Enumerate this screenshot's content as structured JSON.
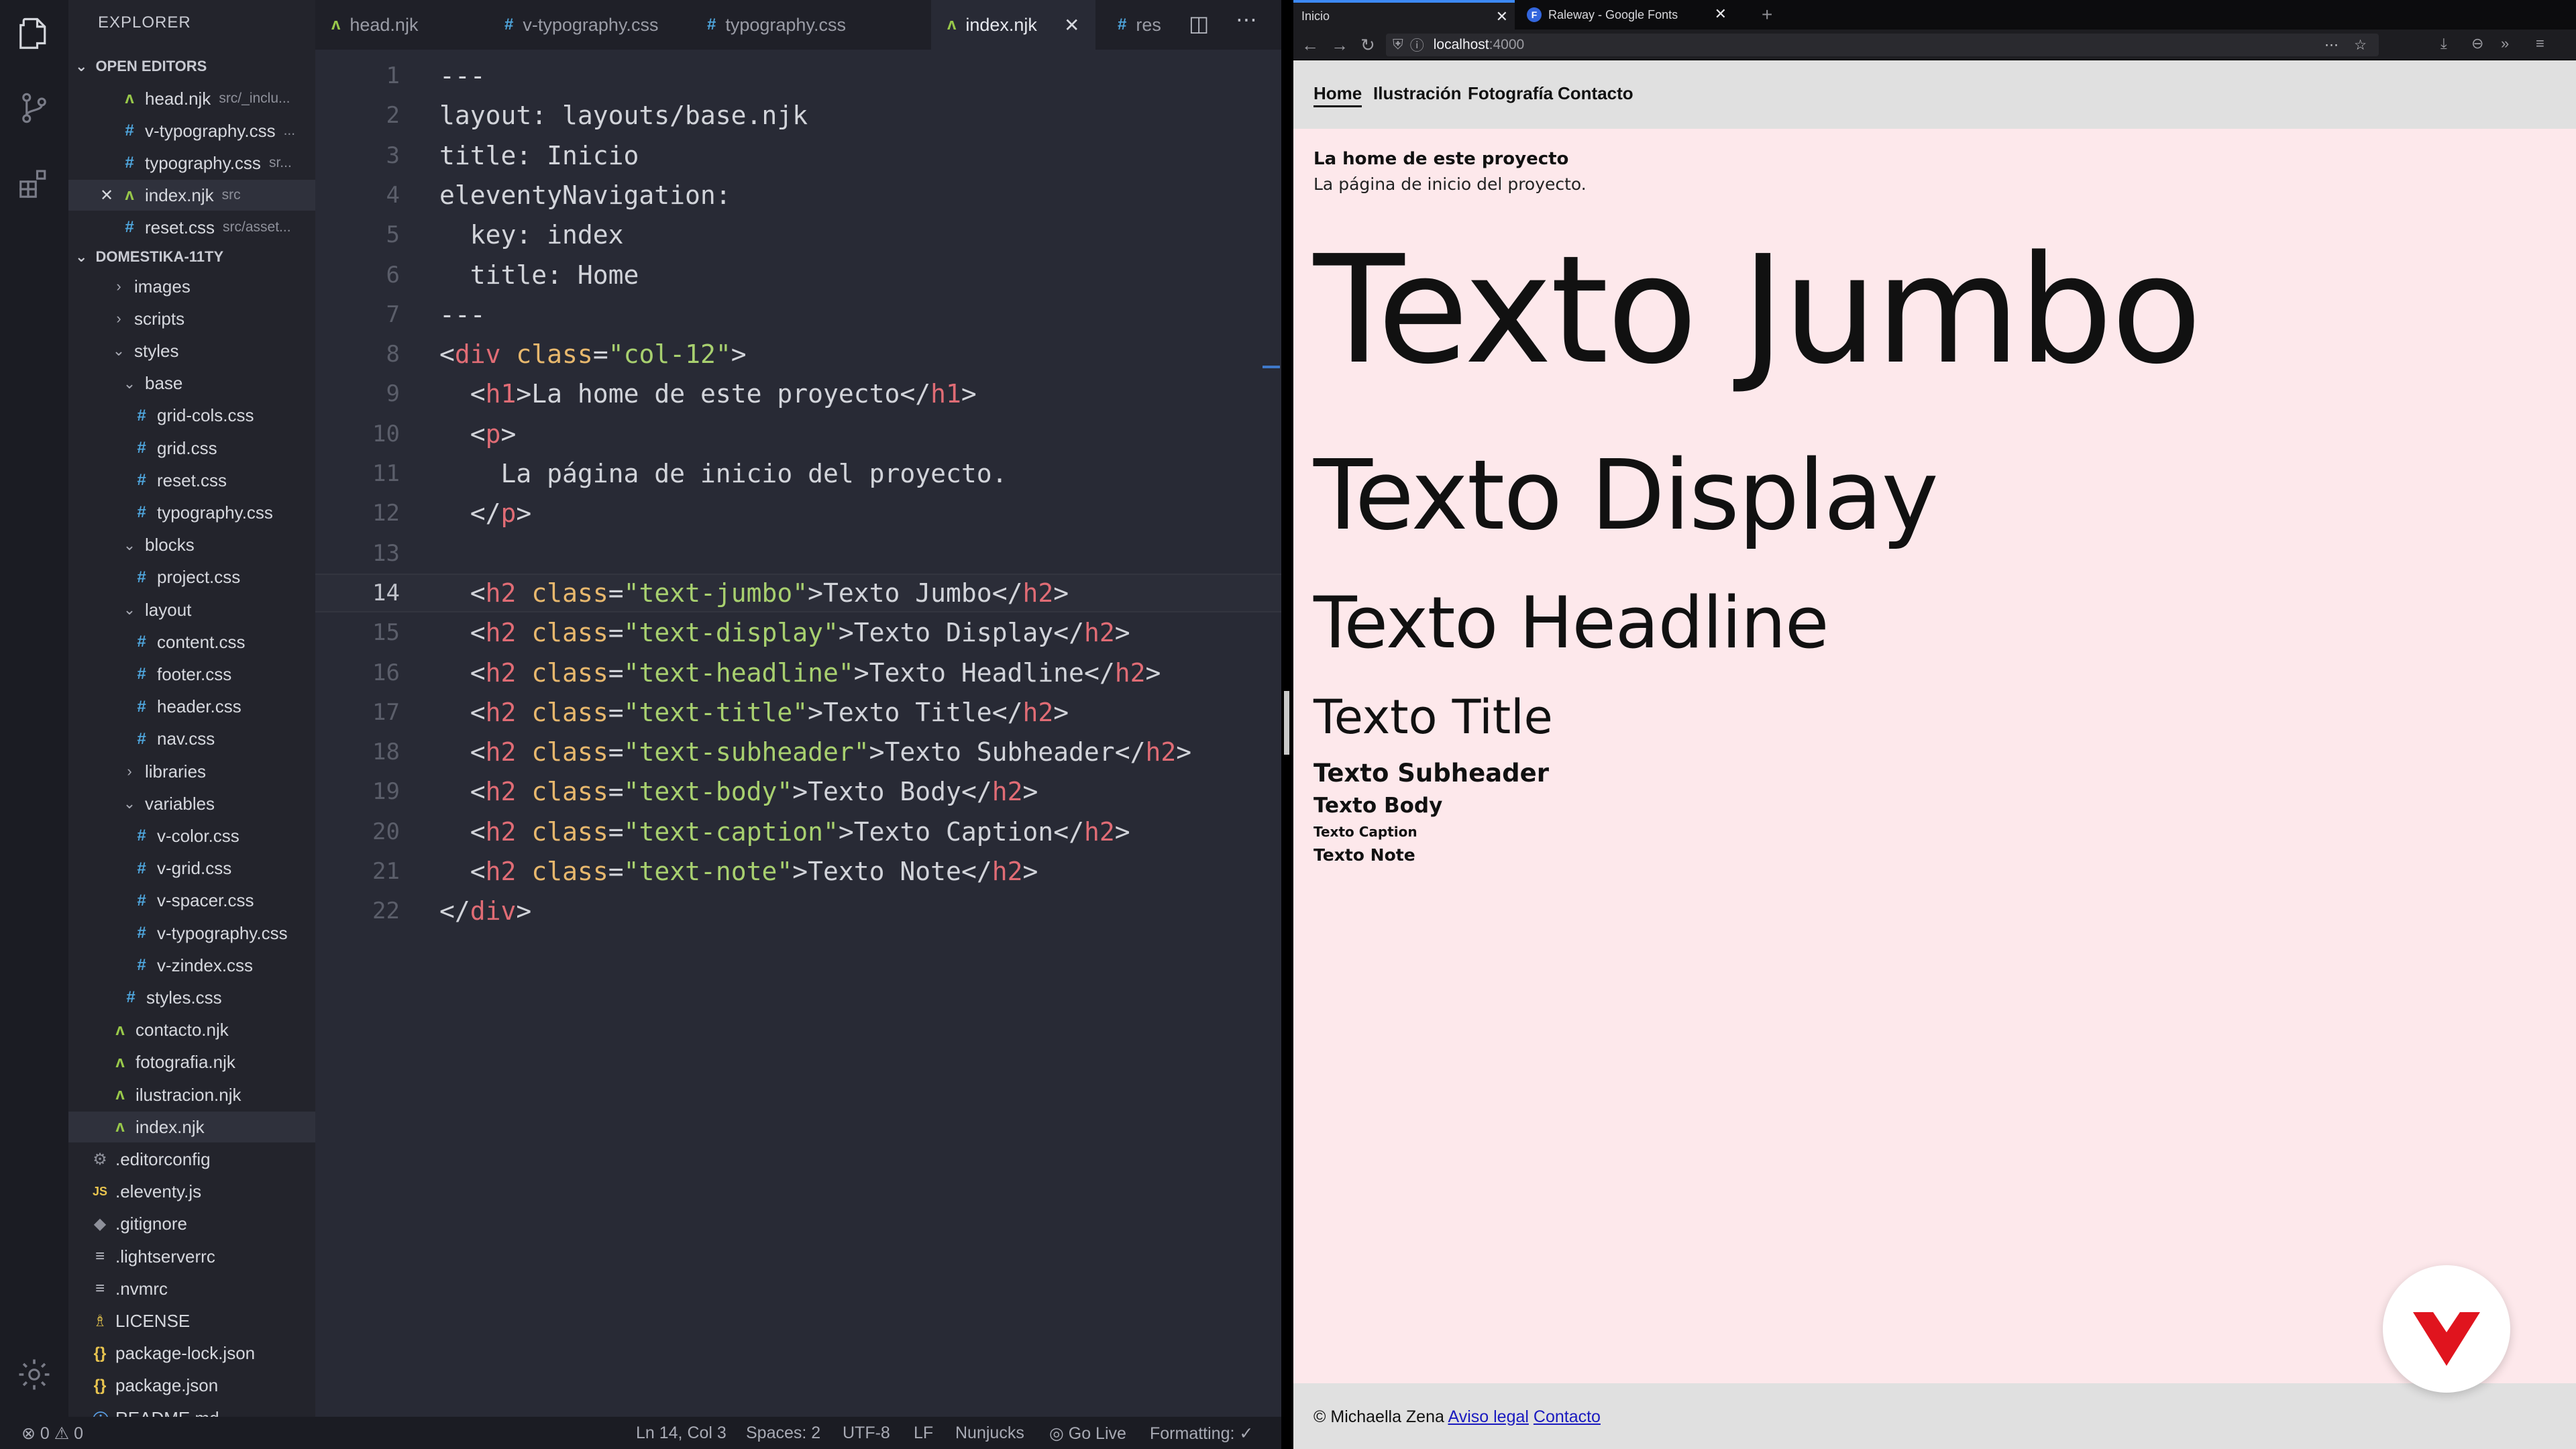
{
  "vscode": {
    "explorer_title": "EXPLORER",
    "open_editors_title": "OPEN EDITORS",
    "open_editors": [
      {
        "name": "head.njk",
        "path": "src/_inclu...",
        "type": "njk"
      },
      {
        "name": "v-typography.css",
        "path": "...",
        "type": "css"
      },
      {
        "name": "typography.css",
        "path": "sr...",
        "type": "css"
      },
      {
        "name": "index.njk",
        "path": "src",
        "type": "njk"
      },
      {
        "name": "reset.css",
        "path": "src/asset...",
        "type": "css"
      }
    ],
    "project_title": "DOMESTIKA-11TY",
    "tree": [
      {
        "label": "images",
        "kind": "folder"
      },
      {
        "label": "scripts",
        "kind": "folder"
      },
      {
        "label": "styles",
        "kind": "folder-open"
      },
      {
        "label": "base",
        "kind": "folder-open"
      },
      {
        "label": "grid-cols.css",
        "kind": "css"
      },
      {
        "label": "grid.css",
        "kind": "css"
      },
      {
        "label": "reset.css",
        "kind": "css"
      },
      {
        "label": "typography.css",
        "kind": "css"
      },
      {
        "label": "blocks",
        "kind": "folder-open"
      },
      {
        "label": "project.css",
        "kind": "css"
      },
      {
        "label": "layout",
        "kind": "folder-open"
      },
      {
        "label": "content.css",
        "kind": "css"
      },
      {
        "label": "footer.css",
        "kind": "css"
      },
      {
        "label": "header.css",
        "kind": "css"
      },
      {
        "label": "nav.css",
        "kind": "css"
      },
      {
        "label": "libraries",
        "kind": "folder"
      },
      {
        "label": "variables",
        "kind": "folder-open"
      },
      {
        "label": "v-color.css",
        "kind": "css"
      },
      {
        "label": "v-grid.css",
        "kind": "css"
      },
      {
        "label": "v-spacer.css",
        "kind": "css"
      },
      {
        "label": "v-typography.css",
        "kind": "css"
      },
      {
        "label": "v-zindex.css",
        "kind": "css"
      },
      {
        "label": "styles.css",
        "kind": "css"
      },
      {
        "label": "contacto.njk",
        "kind": "njk"
      },
      {
        "label": "fotografia.njk",
        "kind": "njk"
      },
      {
        "label": "ilustracion.njk",
        "kind": "njk"
      },
      {
        "label": "index.njk",
        "kind": "njk"
      },
      {
        "label": ".editorconfig",
        "kind": "cfg"
      },
      {
        "label": ".eleventy.js",
        "kind": "js"
      },
      {
        "label": ".gitignore",
        "kind": "git"
      },
      {
        "label": ".lightserverrc",
        "kind": "lines"
      },
      {
        "label": ".nvmrc",
        "kind": "lines"
      },
      {
        "label": "LICENSE",
        "kind": "lic"
      },
      {
        "label": "package-lock.json",
        "kind": "json"
      },
      {
        "label": "package.json",
        "kind": "json"
      },
      {
        "label": "README.md",
        "kind": "info"
      }
    ],
    "tabs": [
      {
        "label": "head.njk",
        "type": "njk"
      },
      {
        "label": "v-typography.css",
        "type": "css"
      },
      {
        "label": "typography.css",
        "type": "css"
      },
      {
        "label": "index.njk",
        "type": "njk"
      },
      {
        "label": "res",
        "type": "css"
      }
    ],
    "code_lines": [
      "---",
      "layout: layouts/base.njk",
      "title: Inicio",
      "eleventyNavigation:",
      "  key: index",
      "  title: Home",
      "---",
      "<div class=\"col-12\">",
      "  <h1>La home de este proyecto</h1>",
      "  <p>",
      "    La página de inicio del proyecto.",
      "  </p>",
      "",
      "  <h2 class=\"text-jumbo\">Texto Jumbo</h2>",
      "  <h2 class=\"text-display\">Texto Display</h2>",
      "  <h2 class=\"text-headline\">Texto Headline</h2>",
      "  <h2 class=\"text-title\">Texto Title</h2>",
      "  <h2 class=\"text-subheader\">Texto Subheader</h2>",
      "  <h2 class=\"text-body\">Texto Body</h2>",
      "  <h2 class=\"text-caption\">Texto Caption</h2>",
      "  <h2 class=\"text-note\">Texto Note</h2>",
      "</div>"
    ],
    "current_line": 14,
    "status": {
      "problems": "⊗ 0 ⚠ 0",
      "position": "Ln 14, Col 3",
      "spaces": "Spaces: 2",
      "encoding": "UTF-8",
      "eol": "LF",
      "language": "Nunjucks",
      "golive": "Go Live",
      "formatting": "Formatting: ✓"
    }
  },
  "browser": {
    "tabs": [
      {
        "title": "Inicio"
      },
      {
        "title": "Raleway - Google Fonts"
      }
    ],
    "url_host": "localhost",
    "url_port": ":4000",
    "site_nav": [
      "Home",
      "Ilustración",
      "Fotografía",
      "Contacto"
    ],
    "page": {
      "h1": "La home de este proyecto",
      "intro": "La página de inicio del proyecto.",
      "jumbo": "Texto Jumbo",
      "display": "Texto Display",
      "headline": "Texto Headline",
      "title": "Texto Title",
      "subheader": "Texto Subheader",
      "body": "Texto Body",
      "caption": "Texto Caption",
      "note": "Texto Note"
    },
    "footer": {
      "copyright": "© Michaella Zena",
      "legal": "Aviso legal",
      "contact": "Contacto"
    }
  },
  "colors": {
    "page_bg": "#fde8eb",
    "nav_bg": "#e0e0e0",
    "brand_red": "#e0141e",
    "accent_blue": "#3d8af7"
  }
}
